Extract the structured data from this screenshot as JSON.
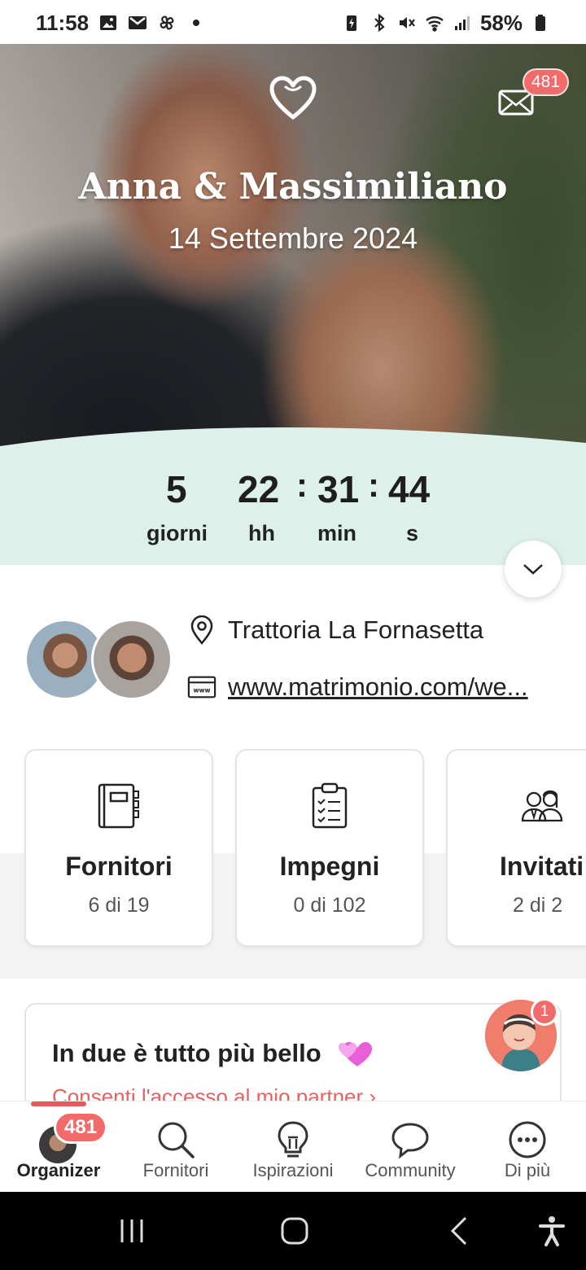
{
  "status_bar": {
    "time": "11:58",
    "battery": "58%",
    "left_icons": [
      "image-icon",
      "gmail-icon",
      "pinwheel-icon",
      "dot-icon"
    ],
    "right_icons": [
      "battery-saver-icon",
      "bluetooth-icon",
      "mute-icon",
      "wifi-icon",
      "signal-icon",
      "battery-icon"
    ]
  },
  "hero": {
    "names": "Anna & Massimiliano",
    "date": "14 Settembre 2024",
    "mail_badge": "481"
  },
  "countdown": {
    "days": "5",
    "hours": "22",
    "minutes": "31",
    "seconds": "44",
    "separator": ":",
    "days_label": "giorni",
    "hours_label": "hh",
    "minutes_label": "min",
    "seconds_label": "s"
  },
  "info": {
    "venue": "Trattoria La Fornasetta",
    "website": "www.matrimonio.com/we..."
  },
  "cards": [
    {
      "title": "Fornitori",
      "count": "6 di 19",
      "icon": "notebook-icon"
    },
    {
      "title": "Impegni",
      "count": "0 di 102",
      "icon": "checklist-icon"
    },
    {
      "title": "Invitati",
      "count": "2 di 2",
      "icon": "guests-icon"
    }
  ],
  "partner": {
    "title": "In due è tutto più bello",
    "link": "Consenti l'accesso al mio partner",
    "support_badge": "1"
  },
  "bottom_nav": {
    "badge": "481",
    "items": [
      {
        "label": "Organizer",
        "icon": "avatar",
        "active": true
      },
      {
        "label": "Fornitori",
        "icon": "search-icon",
        "active": false
      },
      {
        "label": "Ispirazioni",
        "icon": "lightbulb-icon",
        "active": false
      },
      {
        "label": "Community",
        "icon": "chat-bubble-icon",
        "active": false
      },
      {
        "label": "Di più",
        "icon": "more-icon",
        "active": false
      }
    ]
  },
  "colors": {
    "accent": "#e55a5a",
    "badge": "#f26b6b",
    "countdown_bg": "#def0ea"
  }
}
